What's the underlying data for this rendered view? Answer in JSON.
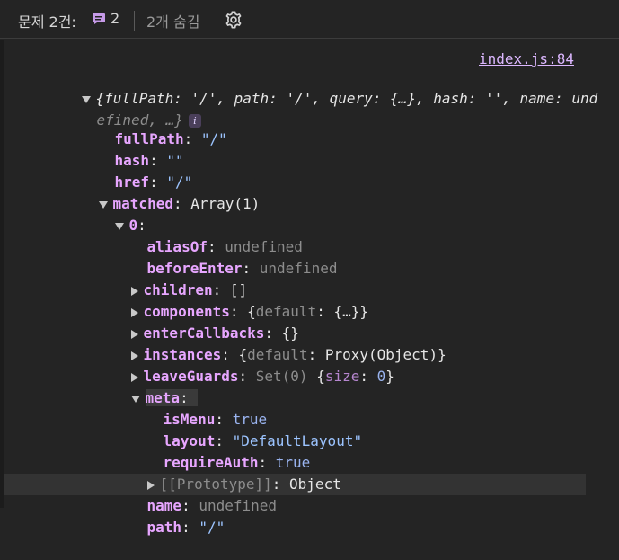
{
  "topbar": {
    "issues_label": "문제 2건:",
    "message_count": "2",
    "hidden_label": "2개 숨김",
    "gear_icon": "gear-icon",
    "message_icon": "message-icon"
  },
  "console": {
    "source_link": "index.js:84",
    "summary": {
      "part1": "{fullPath: '/', path: '/', query: {…}, hash: '', name: und",
      "part2": "efined, …}",
      "info_badge": "i"
    },
    "lines": {
      "fullPath": {
        "key": "fullPath",
        "value": "\"/\""
      },
      "hash": {
        "key": "hash",
        "value": "\"\""
      },
      "href": {
        "key": "href",
        "value": "\"/\""
      },
      "matched": {
        "key": "matched",
        "value": "Array(1)"
      },
      "index0": {
        "key": "0"
      },
      "aliasOf": {
        "key": "aliasOf",
        "value": "undefined"
      },
      "beforeEnter": {
        "key": "beforeEnter",
        "value": "undefined"
      },
      "children": {
        "key": "children",
        "value": "[]"
      },
      "components": {
        "key": "components",
        "open": "{",
        "inner_key": "default",
        "inner_value": "{…}",
        "close": "}"
      },
      "enterCallbacks": {
        "key": "enterCallbacks",
        "value": "{}"
      },
      "instances": {
        "key": "instances",
        "open": "{",
        "inner_key": "default",
        "inner_value": "Proxy(Object)",
        "close": "}"
      },
      "leaveGuards": {
        "key": "leaveGuards",
        "prefix": "Set(0)",
        "open": "{",
        "inner_key": "size",
        "inner_value": "0",
        "close": "}"
      },
      "meta": {
        "key": "meta"
      },
      "isMenu": {
        "key": "isMenu",
        "value": "true"
      },
      "layout": {
        "key": "layout",
        "value": "\"DefaultLayout\""
      },
      "requireAuth": {
        "key": "requireAuth",
        "value": "true"
      },
      "prototype": {
        "key": "[[Prototype]]",
        "value": "Object"
      },
      "name": {
        "key": "name",
        "value": "undefined"
      },
      "path": {
        "key": "path",
        "value": "\"/\""
      }
    }
  },
  "colors": {
    "background": "#242424",
    "key": "#e7a6ff",
    "string": "#9cc4ff",
    "literal": "#9ab4f0",
    "dim": "#8d8d8d",
    "link": "#dcb7ff"
  }
}
